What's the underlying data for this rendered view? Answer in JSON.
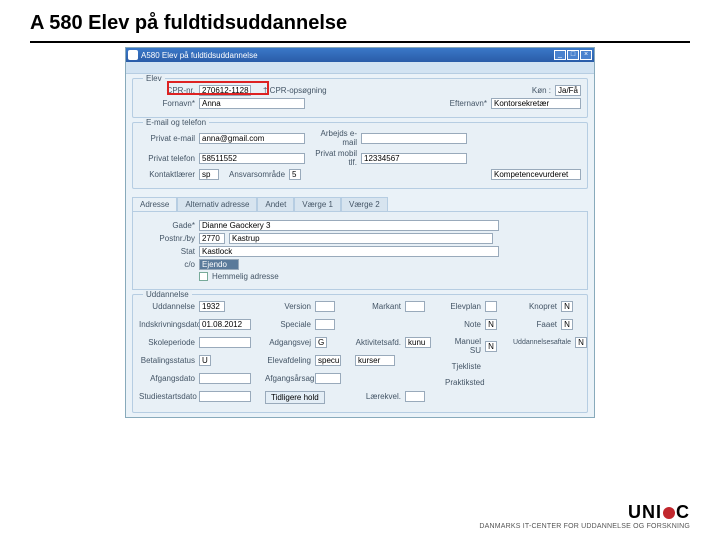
{
  "page_title": "A 580 Elev på fuldtidsuddannelse",
  "titlebar": "A580 Elev på fuldtidsuddannelse",
  "section_elev": {
    "legend": "Elev",
    "cpr_lbl": "CPR-nr.",
    "cpr": "270612-1128",
    "opslag": "† CPR-opsøgning",
    "fornavn_lbl": "Fornavn*",
    "fornavn": "Anna",
    "efternavn_lbl": "Efternavn*",
    "efternavn": "Kontorsekretær",
    "kon_lbl": "Køn   :",
    "kon": "Ja/Få"
  },
  "section_kontakt": {
    "legend": "E-mail og telefon",
    "privat_mail_lbl": "Privat e-mail",
    "privat_mail": "anna@gmail.com",
    "arb_mail_lbl": "Arbejds e-mail",
    "arb_mail": "",
    "priv_tel_lbl": "Privat telefon",
    "priv_tel": "58511552",
    "priv_mob_lbl": "Privat mobil tlf.",
    "priv_mob": "12334567",
    "kontakt_lbl": "Kontaktlærer",
    "kontakt_val": "sp",
    "ansvar_lbl": "Ansvarsområde",
    "omrade_val": "5",
    "kompetence": "Kompetencevurderet"
  },
  "tabs": {
    "adresse": "Adresse",
    "alt": "Alternativ adresse",
    "andet": "Andet",
    "v1": "Værge 1",
    "v2": "Værge 2"
  },
  "adresse": {
    "gade_lbl": "Gade*",
    "gade": "Dianne Gaockery 3",
    "post_lbl": "Postnr./by",
    "post": "2770",
    "by": "Kastrup",
    "stat_lbl": "Stat",
    "stat": "Kastlock",
    "co_lbl": "c/o",
    "co": "Ejendo",
    "hemmelig": "Hemmelig adresse"
  },
  "udd": {
    "legend": "Uddannelse",
    "udd_lbl": "Uddannelse",
    "udd": "1932",
    "ver_lbl": "Version",
    "indskr_lbl": "Indskrivningsdato",
    "indskr": "01.08.2012",
    "spec_lbl": "Speciale",
    "skp_lbl": "Skoleperiode",
    "adgvej_lbl": "Adgangsvej",
    "adgvej": "G",
    "betaling_lbl": "Betalingsstatus",
    "betaling": "U",
    "elevafd_lbl": "Elevafdeling",
    "elevafd": "specu",
    "afg_lbl": "Afgangsdato",
    "afgaar_lbl": "Afgangsårsag",
    "studie_lbl": "Studiestartsdato",
    "tidl_btn": "Tidligere hold",
    "markant_lbl": "Markant",
    "aktivitet_lbl": "Aktivitetsafd.",
    "aktivitet": "kunu",
    "elevplan_lbl": "Elevplan",
    "note_lbl": "Note",
    "manuel_lbl": "Manuel SU",
    "tjek_lbl": "Tjekliste",
    "praktik_lbl": "Praktiksted",
    "laerkvel_lbl": "Lærekvel.",
    "knopret_lbl": "Knopret",
    "faaene_lbl": "Faaet",
    "uddseskeapr_lbl": "Uddannelsesaftale",
    "kurser": "kurser",
    "n": "N"
  },
  "logo": {
    "brand1": "UNI",
    "brand2": "C",
    "sub": "DANMARKS IT-CENTER FOR UDDANNELSE OG FORSKNING"
  }
}
